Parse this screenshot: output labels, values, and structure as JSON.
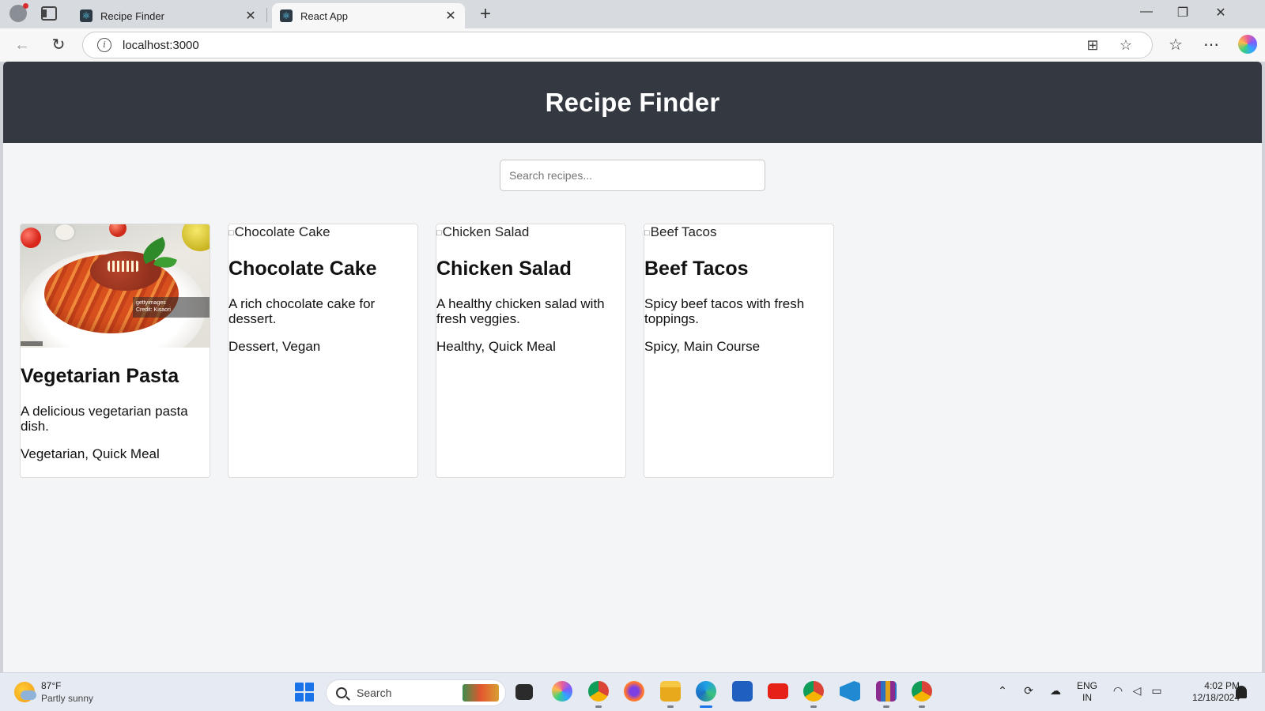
{
  "browser": {
    "tabs": [
      {
        "label": "Recipe Finder",
        "close": "✕"
      },
      {
        "label": "React App",
        "close": "✕"
      }
    ],
    "new_tab": "+",
    "window_controls": {
      "minimize": "—",
      "restore": "❐",
      "close": "✕"
    },
    "url": "localhost:3000",
    "toolbar_icons": [
      "back-icon",
      "reload-icon",
      "info-icon",
      "app-available-icon",
      "favorite-star-icon",
      "favorites-icon",
      "more-icon",
      "copilot-icon"
    ]
  },
  "app": {
    "title": "Recipe Finder",
    "search": {
      "placeholder": "Search recipes...",
      "value": ""
    },
    "recipes": [
      {
        "image_alt": "Vegetarian Pasta",
        "image_loaded": true,
        "watermark": "gettyimages",
        "watermark_credit": "Credit: Kisaori",
        "name": "Vegetarian Pasta",
        "description": "A delicious vegetarian pasta dish.",
        "tags": "Vegetarian, Quick Meal"
      },
      {
        "image_alt": "Chocolate Cake",
        "image_loaded": false,
        "name": "Chocolate Cake",
        "description": "A rich chocolate cake for dessert.",
        "tags": "Dessert, Vegan"
      },
      {
        "image_alt": "Chicken Salad",
        "image_loaded": false,
        "name": "Chicken Salad",
        "description": "A healthy chicken salad with fresh veggies.",
        "tags": "Healthy, Quick Meal"
      },
      {
        "image_alt": "Beef Tacos",
        "image_loaded": false,
        "name": "Beef Tacos",
        "description": "Spicy beef tacos with fresh toppings.",
        "tags": "Spicy, Main Course"
      }
    ]
  },
  "taskbar": {
    "weather": {
      "temp": "87°F",
      "condition": "Partly sunny"
    },
    "search_label": "Search",
    "language": {
      "line1": "ENG",
      "line2": "IN"
    },
    "time": "4:02 PM",
    "date": "12/18/2024",
    "colors": {
      "accent": "#1a73e8",
      "header_bg": "#333841",
      "page_bg": "#f4f5f7"
    }
  }
}
